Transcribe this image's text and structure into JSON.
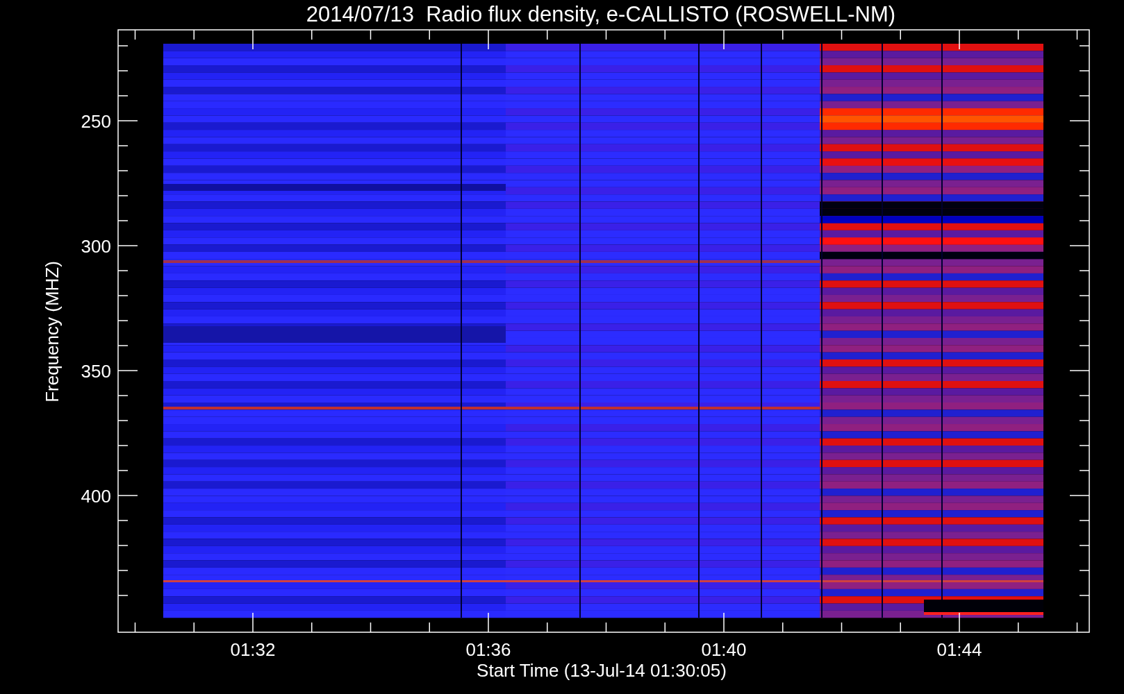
{
  "title": "2014/07/13  Radio flux density, e-CALLISTO (ROSWELL-NM)",
  "ylabel": "Frequency (MHZ)",
  "yticks": [
    "250",
    "300",
    "350",
    "400"
  ],
  "xticks": [
    "01:32",
    "01:36",
    "01:40",
    "01:44"
  ],
  "xlabel": "Start Time (13-Jul-14 01:30:05)"
}
